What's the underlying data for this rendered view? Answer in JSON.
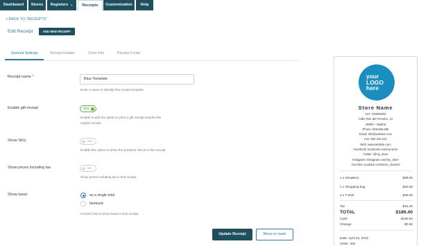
{
  "nav": {
    "tabs": [
      {
        "label": "Dashboard"
      },
      {
        "label": "Stores"
      },
      {
        "label": "Registers"
      },
      {
        "label": "Receipts"
      },
      {
        "label": "Customization"
      },
      {
        "label": "Help"
      }
    ]
  },
  "back_link": "< BACK TO \"RECEIPTS\"",
  "page": {
    "title": "Edit Receipt",
    "add_button": "ADD NEW RECEIPT"
  },
  "subtabs": [
    {
      "label": "General Settings"
    },
    {
      "label": "Receipt Header"
    },
    {
      "label": "Order Info"
    },
    {
      "label": "Receipt Footer"
    }
  ],
  "form": {
    "receipt_name": {
      "label": "Receipt name",
      "required": "*",
      "value": "Blue Template",
      "help": "Enter a name to identify this receipt template"
    },
    "gift_receipt": {
      "label": "Enable gift receipt",
      "toggle": "YES",
      "help_1": "Enable to add the option to print a gift receipt besides the",
      "help_2": "regular receipt."
    },
    "show_sku": {
      "label": "Show SKU",
      "toggle": "NO",
      "help": "Enable this option to show the products' SKUs in this receipt."
    },
    "show_prices_tax": {
      "label": "Show prices including tax",
      "toggle": "NO",
      "help": "Show prices including tax in this receipt."
    },
    "show_taxes": {
      "label": "Show taxes",
      "option_1": "as a single total",
      "option_2": "Itemized",
      "help": "Choose how to show taxes in this receipt."
    }
  },
  "actions": {
    "update": "Update Receipt",
    "trash": "Move to trash"
  },
  "receipt_preview": {
    "logo": [
      "your",
      "LOGO",
      "here"
    ],
    "store_name": "Store Name",
    "lines": [
      "VAT: 333000000",
      "Calle Rúe del Percebe, 13",
      "28000 – Madrid",
      "Phone: 555.555.666",
      "Email: info@website.com",
      "Fax: 555.444.222",
      "Web: www.website.com",
      "Facebook: facebook.com/my-store",
      "Twitter: @my_store",
      "Instagram: instagram.com/my_store",
      "YouTube: youtube.com/store_channel"
    ],
    "items": [
      {
        "name": "1 x Sneakers",
        "price": "$98.00"
      },
      {
        "name": "1 x Shopping bag",
        "price": "$40.00"
      },
      {
        "name": "2 x T-shirt",
        "price": "$36.00"
      }
    ],
    "tax": {
      "label": "Tax",
      "value": "$15.40"
    },
    "total": {
      "label": "TOTAL",
      "value": "$189.40"
    },
    "cash": {
      "label": "Cash",
      "value": "$190.00"
    },
    "change": {
      "label": "Change",
      "value": "$0.60"
    },
    "date": "Date: April 22, 2022",
    "order": "Order: 452"
  },
  "colors": {
    "nav_bg": "#1f4f5c",
    "accent": "#2f7d9c",
    "toggle_on": "#6aa84f",
    "logo_bg": "#1b8ec0"
  }
}
